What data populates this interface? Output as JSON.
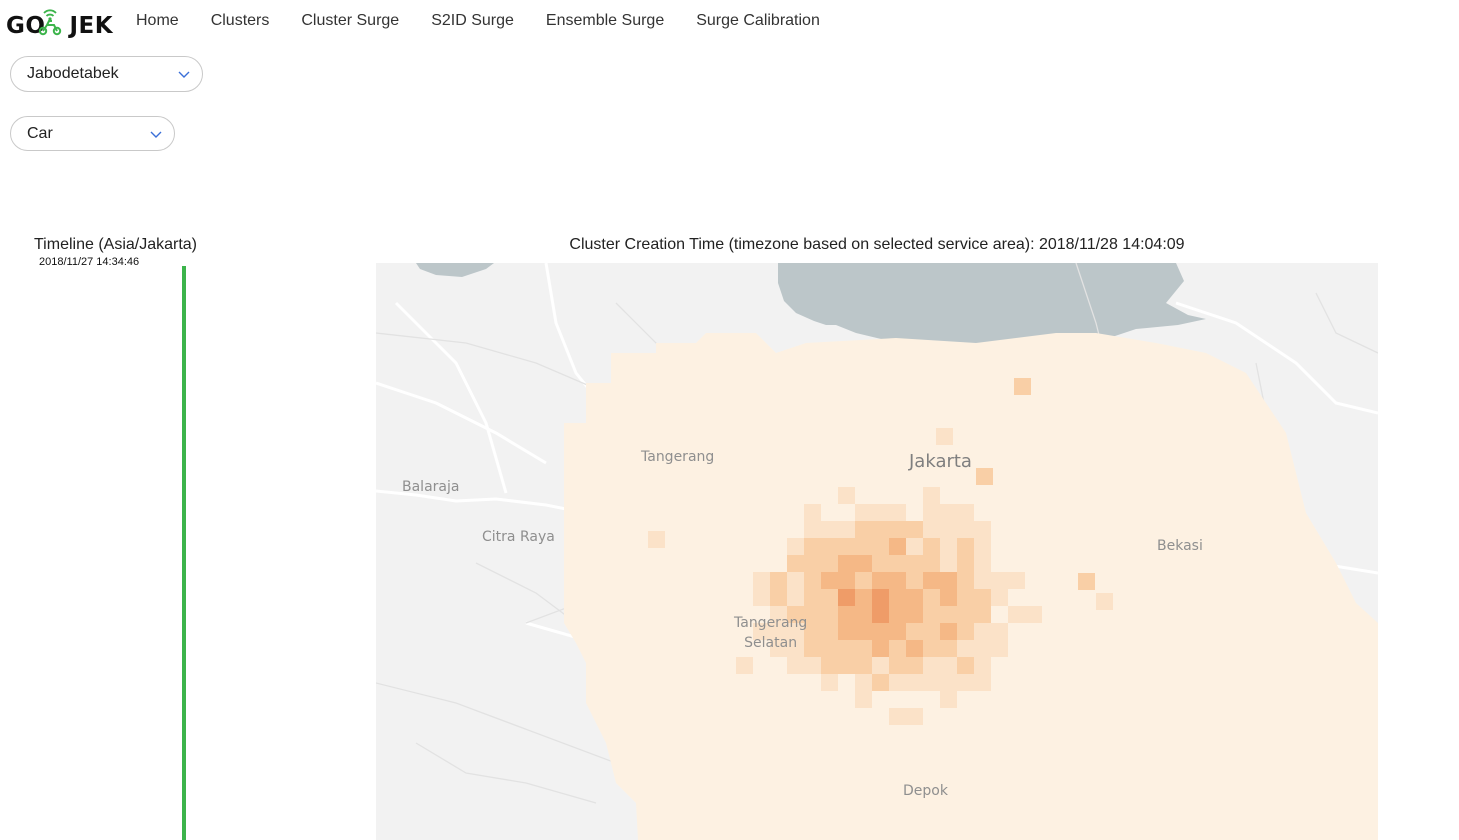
{
  "brand": {
    "name_left": "GO",
    "name_right": "JEK",
    "accent": "#3cb44b"
  },
  "nav": {
    "items": [
      "Home",
      "Clusters",
      "Cluster Surge",
      "S2ID Surge",
      "Ensemble Surge",
      "Surge Calibration"
    ]
  },
  "filters": {
    "service_area": {
      "value": "Jabodetabek",
      "icon": "chevron-down-icon"
    },
    "service_type": {
      "value": "Car",
      "icon": "chevron-down-icon"
    }
  },
  "timeline": {
    "title": "Timeline (Asia/Jakarta)",
    "first_timestamp": "2018/11/27 14:34:46",
    "bar_color": "#3cb44b"
  },
  "map": {
    "caption": "Cluster Creation Time (timezone based on selected service area): 2018/11/28 14:04:09",
    "labels": {
      "jakarta": "Jakarta",
      "tangerang": "Tangerang",
      "balaraja": "Balaraja",
      "citra_raya": "Citra Raya",
      "bekasi": "Bekasi",
      "tangerang_selatan_1": "Tangerang",
      "tangerang_selatan_2": "Selatan",
      "depok": "Depok"
    },
    "heat_colors": [
      "#fdf1e2",
      "#fbe2c8",
      "#f9cfa6",
      "#f5b886",
      "#ef9c68"
    ],
    "sea_color": "#bcc6c9"
  }
}
